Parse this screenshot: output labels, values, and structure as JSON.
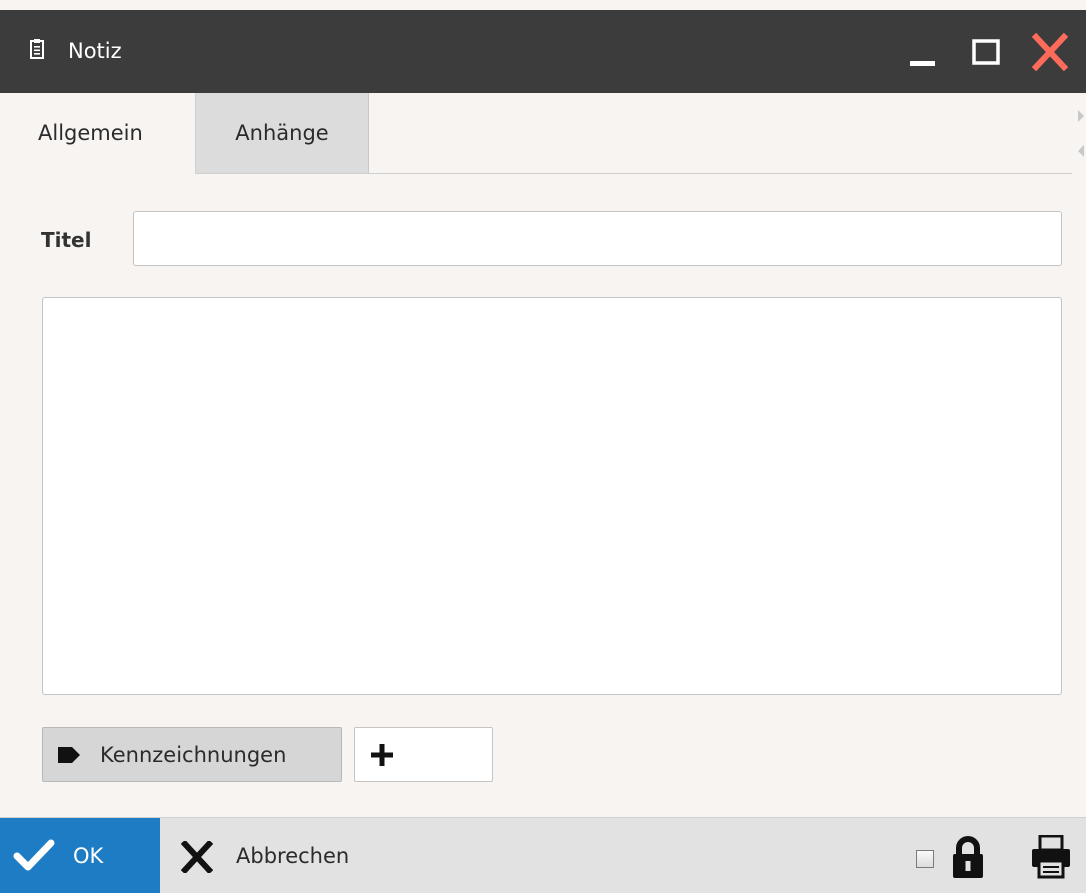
{
  "window": {
    "title": "Notiz",
    "title_icon": "clipboard-icon",
    "controls": {
      "minimize_icon": "minimize-icon",
      "maximize_icon": "maximize-icon",
      "close_icon": "close-icon",
      "close_color": "#ff6b5a"
    },
    "titlebar_color": "#3c3c3c"
  },
  "tabs": [
    {
      "label": "Allgemein",
      "active": true
    },
    {
      "label": "Anhänge",
      "active": false
    }
  ],
  "form": {
    "title_label": "Titel",
    "title_value": "",
    "title_placeholder": "",
    "body_value": "",
    "body_placeholder": ""
  },
  "tags": {
    "button_label": "Kennzeichnungen",
    "button_icon": "tag-icon",
    "add_icon": "plus-icon"
  },
  "footer": {
    "ok_label": "OK",
    "ok_icon": "checkmark-icon",
    "ok_color": "#1e7cc4",
    "cancel_label": "Abbrechen",
    "cancel_icon": "x-icon",
    "lock_checked": false,
    "lock_icon": "lock-icon",
    "print_icon": "printer-icon"
  }
}
